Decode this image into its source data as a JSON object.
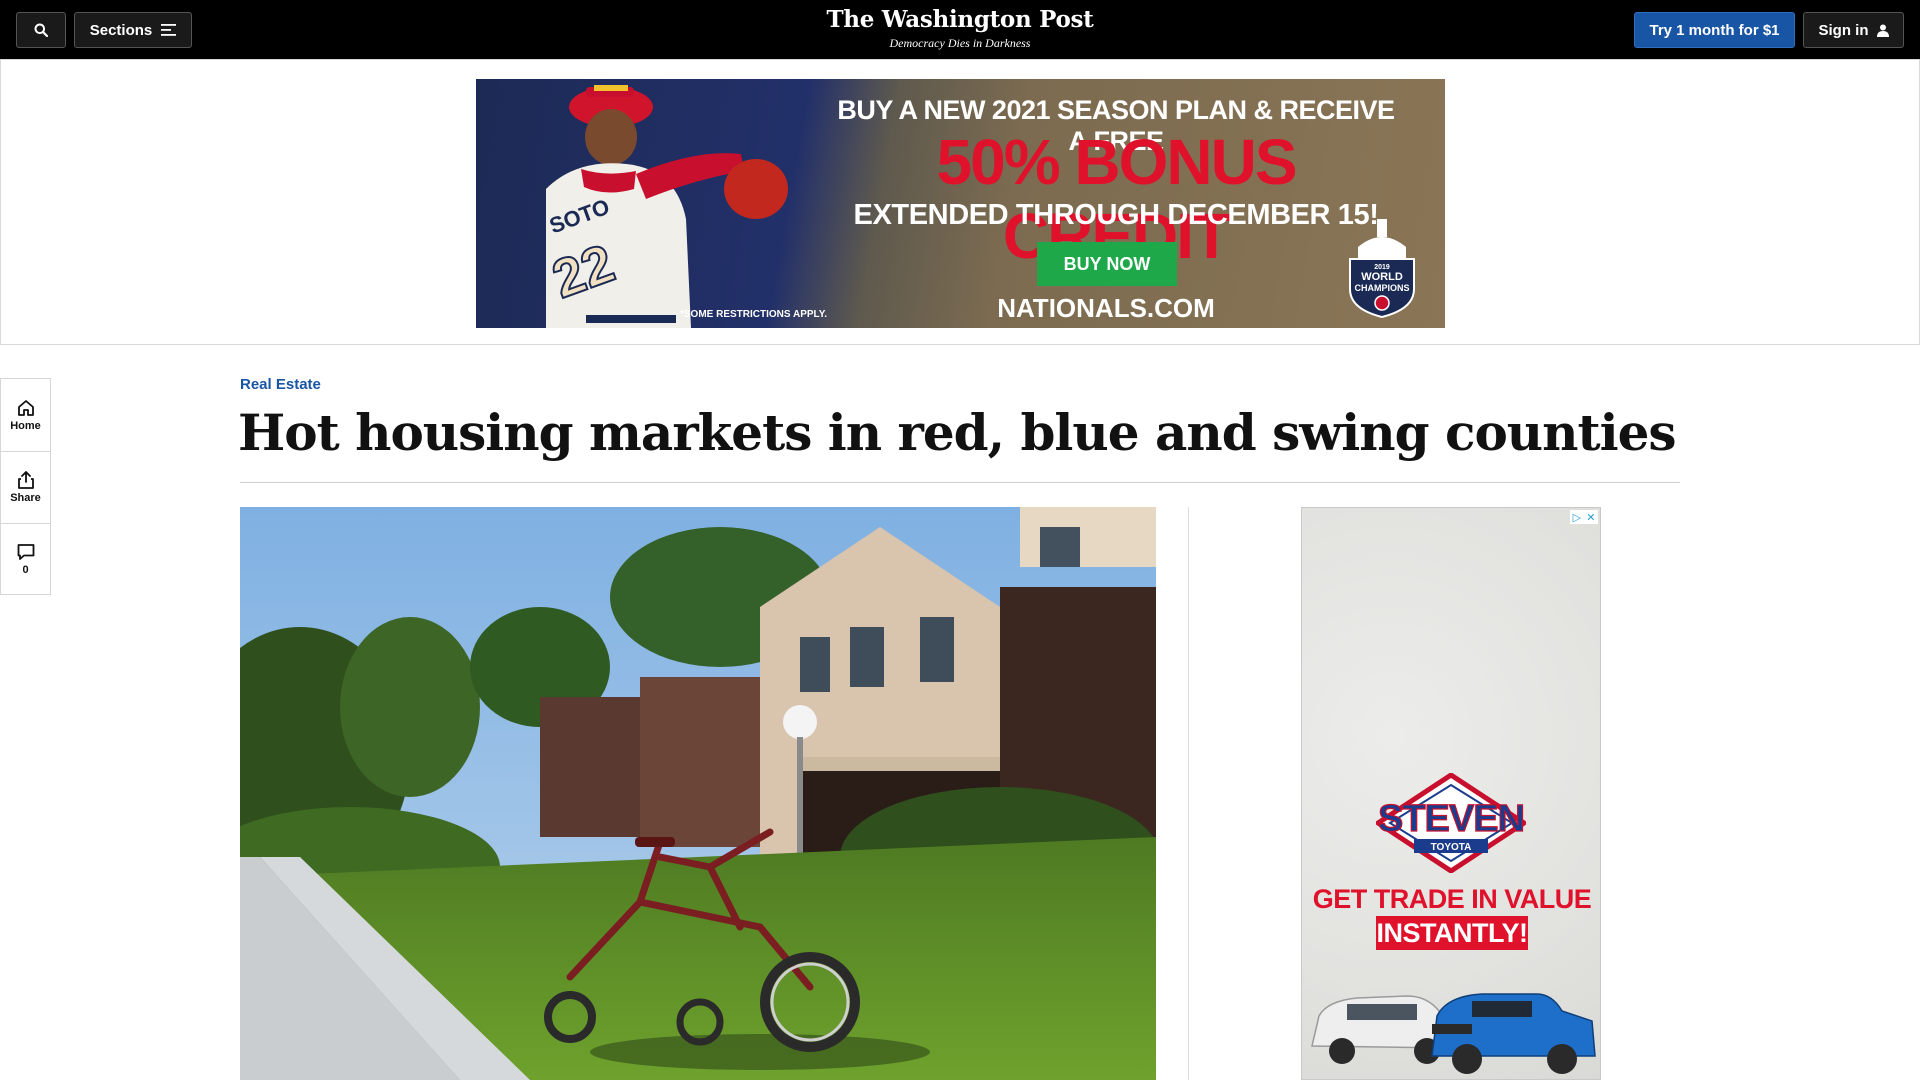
{
  "header": {
    "sections_label": "Sections",
    "logo_text": "The Washington Post",
    "tagline": "Democracy Dies in Darkness",
    "trial_label": "Try 1 month for $1",
    "signin_label": "Sign in"
  },
  "top_ad": {
    "line1": "BUY A NEW 2021 SEASON PLAN & RECEIVE A FREE",
    "line2": "50% BONUS CREDIT",
    "line3": "EXTENDED THROUGH DECEMBER 15!",
    "button": "BUY NOW",
    "site": "NATIONALS.COM",
    "fine_print": "*SOME RESTRICTIONS APPLY.",
    "jersey_name": "SOTO",
    "jersey_number": "22",
    "badge_year": "2019",
    "badge_line1": "WORLD",
    "badge_line2": "CHAMPIONS"
  },
  "left_rail": {
    "home_label": "Home",
    "share_label": "Share",
    "comments_count": "0"
  },
  "article": {
    "kicker": "Real Estate",
    "headline": "Hot housing markets in red, blue and swing counties"
  },
  "side_ad": {
    "brand": "STEVEN",
    "sub_brand": "TOYOTA",
    "line1": "GET TRADE IN VALUE",
    "line2": "INSTANTLY!"
  },
  "colors": {
    "accent_blue": "#1955a5",
    "ad_red": "#e0112b",
    "ad_green": "#1fa84a"
  },
  "icons": {
    "search": "search-icon",
    "sections": "menu-icon",
    "signin": "user-icon",
    "home": "home-icon",
    "share": "share-icon",
    "comments": "comment-icon",
    "ad_choices": "ad-choices-icon",
    "ad_close": "close-icon"
  }
}
